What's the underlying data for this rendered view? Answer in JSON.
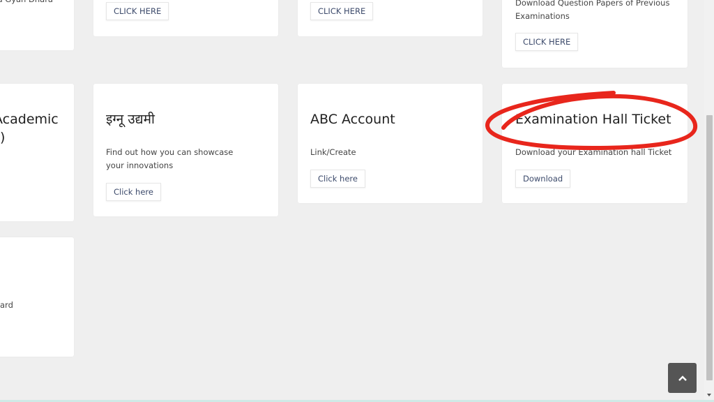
{
  "cards": [
    {
      "title": "",
      "desc": "and Gyan Dhara",
      "button": ""
    },
    {
      "title": "",
      "desc": "",
      "button": "CLICK HERE"
    },
    {
      "title": "",
      "desc": "",
      "button": "CLICK HERE"
    },
    {
      "title": "",
      "desc": "Download Question Papers of Previous Examinations",
      "button": "CLICK HERE"
    },
    {
      "title": "Academic\nS)",
      "title_line1": "Academic",
      "title_line2": "S)",
      "desc": "",
      "button": ""
    },
    {
      "title": "इग्नू उद्यमी",
      "desc": "Find out how you can showcase your innovations",
      "button": "Click here"
    },
    {
      "title": "ABC Account",
      "desc": "Link/Create",
      "button": "Click here"
    },
    {
      "title": "Examination Hall Ticket",
      "desc": "Download your Examination hall Ticket",
      "button": "Download"
    },
    {
      "title": "",
      "desc": "ard",
      "button": ""
    }
  ],
  "back_to_top_icon": "chevron-up-icon",
  "annotation_color": "#e8261c"
}
